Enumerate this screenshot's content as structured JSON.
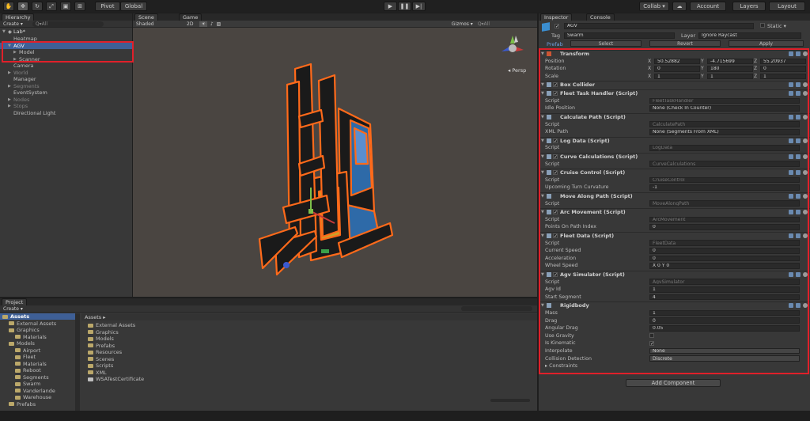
{
  "toolbar": {
    "pivot": "Pivot",
    "global": "Global",
    "collab": "Collab ▾",
    "account": "Account",
    "layers": "Layers",
    "layout": "Layout"
  },
  "hierarchy": {
    "tab": "Hierarchy",
    "create": "Create ▾",
    "search": "Q▾All",
    "scene": "Lab*",
    "items": [
      {
        "label": "Heatmap",
        "indent": 1,
        "state": "normal",
        "arrow": ""
      },
      {
        "label": "AGV",
        "indent": 1,
        "state": "selected",
        "arrow": "▼"
      },
      {
        "label": "Model",
        "indent": 2,
        "state": "normal",
        "arrow": "▶"
      },
      {
        "label": "Scanner",
        "indent": 2,
        "state": "normal",
        "arrow": "▶"
      },
      {
        "label": "Camera",
        "indent": 1,
        "state": "normal",
        "arrow": ""
      },
      {
        "label": "World",
        "indent": 1,
        "state": "dim",
        "arrow": "▶"
      },
      {
        "label": "Manager",
        "indent": 1,
        "state": "normal",
        "arrow": ""
      },
      {
        "label": "Segments",
        "indent": 1,
        "state": "dim",
        "arrow": "▶"
      },
      {
        "label": "EventSystem",
        "indent": 1,
        "state": "normal",
        "arrow": ""
      },
      {
        "label": "Nodes",
        "indent": 1,
        "state": "dim",
        "arrow": "▶"
      },
      {
        "label": "Stops",
        "indent": 1,
        "state": "dim",
        "arrow": "▶"
      },
      {
        "label": "Directional Light",
        "indent": 1,
        "state": "normal",
        "arrow": ""
      }
    ]
  },
  "scene_view": {
    "tab_scene": "Scene",
    "tab_game": "Game",
    "shading": "Shaded",
    "mode_2d": "2D",
    "gizmos": "Gizmos ▾",
    "search": "Q▾All",
    "persp": "◂ Persp"
  },
  "project": {
    "tab": "Project",
    "create": "Create ▾",
    "assets_root": "Assets",
    "tree": [
      {
        "label": "Assets",
        "indent": 0,
        "bold": true
      },
      {
        "label": "External Assets",
        "indent": 1
      },
      {
        "label": "Graphics",
        "indent": 1
      },
      {
        "label": "Materials",
        "indent": 2
      },
      {
        "label": "Models",
        "indent": 1
      },
      {
        "label": "Airport",
        "indent": 2
      },
      {
        "label": "Fleet",
        "indent": 2
      },
      {
        "label": "Materials",
        "indent": 2
      },
      {
        "label": "Reboot",
        "indent": 2
      },
      {
        "label": "Segments",
        "indent": 2
      },
      {
        "label": "Swarm",
        "indent": 2
      },
      {
        "label": "Vanderlande",
        "indent": 2
      },
      {
        "label": "Warehouse",
        "indent": 2
      },
      {
        "label": "Prefabs",
        "indent": 1
      }
    ],
    "breadcrumb": "Assets ▸",
    "files": [
      "External Assets",
      "Graphics",
      "Models",
      "Prefabs",
      "Resources",
      "Scenes",
      "Scripts",
      "XML",
      "WSATestCertificate"
    ]
  },
  "inspector": {
    "tab_inspector": "Inspector",
    "tab_console": "Console",
    "object_name": "AGV",
    "static_label": "Static ▾",
    "tag_label": "Tag",
    "tag_value": "Swarm",
    "layer_label": "Layer",
    "layer_value": "Ignore Raycast",
    "prefab_label": "Prefab",
    "prefab_select": "Select",
    "prefab_revert": "Revert",
    "prefab_apply": "Apply",
    "transform": {
      "title": "Transform",
      "rows": [
        {
          "label": "Position",
          "x": "50.52882",
          "y": "-4.715699",
          "z": "55.20937"
        },
        {
          "label": "Rotation",
          "x": "0",
          "y": "180",
          "z": "0"
        },
        {
          "label": "Scale",
          "x": "1",
          "y": "1",
          "z": "1"
        }
      ]
    },
    "components": [
      {
        "title": "Box Collider",
        "checkbox": true,
        "props": []
      },
      {
        "title": "Fleet Task Handler (Script)",
        "checkbox": true,
        "props": [
          {
            "label": "Script",
            "value": "FleetTaskHandler",
            "dim": true
          },
          {
            "label": "Idle Position",
            "value": "None (Check In Counter)",
            "dim": false
          }
        ]
      },
      {
        "title": "Calculate Path (Script)",
        "checkbox": false,
        "props": [
          {
            "label": "Script",
            "value": "CalculatePath",
            "dim": true
          },
          {
            "label": "XML Path",
            "value": "None (Segments From XML)",
            "dim": false
          }
        ]
      },
      {
        "title": "Log Data (Script)",
        "checkbox": true,
        "props": [
          {
            "label": "Script",
            "value": "LogData",
            "dim": true
          }
        ]
      },
      {
        "title": "Curve Calculations (Script)",
        "checkbox": true,
        "props": [
          {
            "label": "Script",
            "value": "CurveCalculations",
            "dim": true
          }
        ]
      },
      {
        "title": "Cruise Control (Script)",
        "checkbox": true,
        "props": [
          {
            "label": "Script",
            "value": "CruiseControl",
            "dim": true
          },
          {
            "label": "Upcoming Turn Curvature",
            "value": "-1",
            "dim": false
          }
        ]
      },
      {
        "title": "Move Along Path (Script)",
        "checkbox": false,
        "props": [
          {
            "label": "Script",
            "value": "MoveAlongPath",
            "dim": true
          }
        ]
      },
      {
        "title": "Arc Movement (Script)",
        "checkbox": true,
        "props": [
          {
            "label": "Script",
            "value": "ArcMovement",
            "dim": true
          },
          {
            "label": "Points On Path Index",
            "value": "0",
            "dim": false
          }
        ]
      },
      {
        "title": "Fleet Data (Script)",
        "checkbox": true,
        "props": [
          {
            "label": "Script",
            "value": "FleetData",
            "dim": true
          },
          {
            "label": "Current Speed",
            "value": "0",
            "dim": false
          },
          {
            "label": "Acceleration",
            "value": "0",
            "dim": false
          },
          {
            "label": "Wheel Speed",
            "value": "X 0          Y 0",
            "dim": false
          }
        ]
      },
      {
        "title": "Agv Simulator (Script)",
        "checkbox": true,
        "props": [
          {
            "label": "Script",
            "value": "AgvSimulator",
            "dim": true
          },
          {
            "label": "Agv Id",
            "value": "1",
            "dim": false
          },
          {
            "label": "Start Segment",
            "value": "4",
            "dim": false
          }
        ]
      },
      {
        "title": "Rigidbody",
        "checkbox": false,
        "props": [
          {
            "label": "Mass",
            "value": "1",
            "dim": false
          },
          {
            "label": "Drag",
            "value": "0",
            "dim": false
          },
          {
            "label": "Angular Drag",
            "value": "0.05",
            "dim": false
          },
          {
            "label": "Use Gravity",
            "value": "",
            "dim": false,
            "check": false
          },
          {
            "label": "Is Kinematic",
            "value": "✓",
            "dim": false,
            "check": true
          },
          {
            "label": "Interpolate",
            "value": "None",
            "dim": false,
            "dropdown": true
          },
          {
            "label": "Collision Detection",
            "value": "Discrete",
            "dim": false,
            "dropdown": true
          },
          {
            "label": "▸ Constraints",
            "value": "",
            "dim": false,
            "none": true
          }
        ]
      }
    ],
    "add_component": "Add Component"
  }
}
